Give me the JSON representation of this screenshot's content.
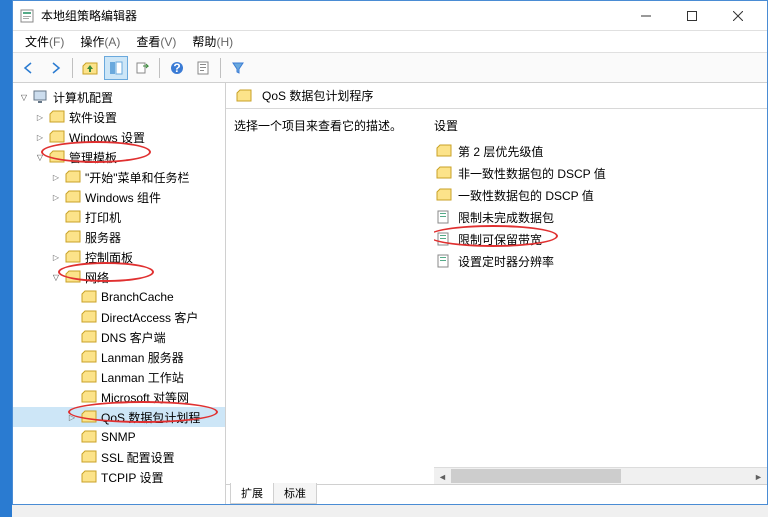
{
  "window": {
    "title": "本地组策略编辑器"
  },
  "menubar": [
    {
      "label": "文件",
      "accel": "F"
    },
    {
      "label": "操作",
      "accel": "A"
    },
    {
      "label": "查看",
      "accel": "V"
    },
    {
      "label": "帮助",
      "accel": "H"
    }
  ],
  "tree": {
    "root": {
      "label": "计算机配置"
    },
    "n_software": "软件设置",
    "n_windows": "Windows 设置",
    "n_admin": "管理模板",
    "n_start": "\"开始\"菜单和任务栏",
    "n_winc": "Windows 组件",
    "n_printer": "打印机",
    "n_server": "服务器",
    "n_cp": "控制面板",
    "n_net": "网络",
    "n_bc": "BranchCache",
    "n_da": "DirectAccess 客户",
    "n_dns": "DNS 客户端",
    "n_ls": "Lanman 服务器",
    "n_lw": "Lanman 工作站",
    "n_ms": "Microsoft 对等网",
    "n_qos": "QoS 数据包计划程",
    "n_snmp": "SNMP",
    "n_ssl": "SSL 配置设置",
    "n_tcpip": "TCPIP 设置"
  },
  "content": {
    "header": "QoS 数据包计划程序",
    "desc": "选择一个项目来查看它的描述。",
    "settings_header": "设置",
    "items": {
      "l2": "第 2 层优先级值",
      "dscp1": "非一致性数据包的 DSCP 值",
      "dscp2": "一致性数据包的 DSCP 值",
      "limit1": "限制未完成数据包",
      "limit2": "限制可保留带宽",
      "timer": "设置定时器分辨率"
    }
  },
  "tabs": {
    "extended": "扩展",
    "standard": "标准"
  }
}
